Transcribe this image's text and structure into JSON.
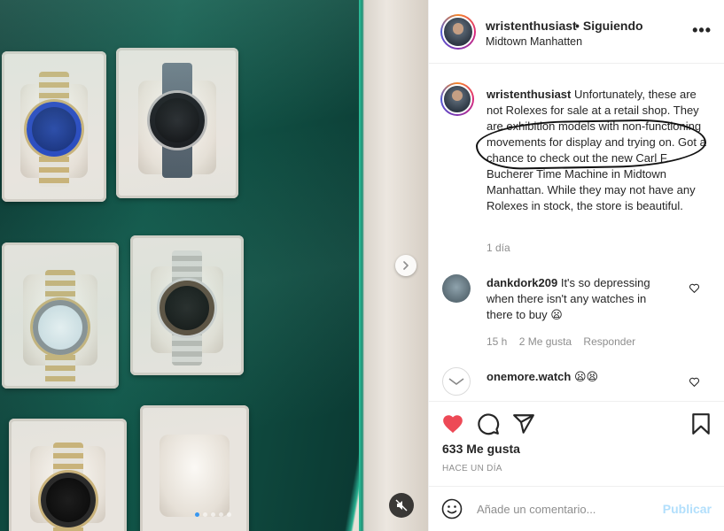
{
  "post": {
    "username": "wristenthusiast",
    "follow_separator": "•",
    "follow_status": "Siguiendo",
    "location": "Midtown Manhatten",
    "more_label": "•••"
  },
  "caption": {
    "username": "wristenthusiast",
    "text": "Unfortunately, these are not Rolexes for sale at a retail shop. They are exhibition models with non-functioning movements for display and trying on. Got a chance to check out the new Carl F. Bucherer Time Machine in Midtown Manhattan. While they may not have any Rolexes in stock, the store is beautiful.",
    "time": "1 día"
  },
  "comments": [
    {
      "username": "dankdork209",
      "text": "It's so depressing when there isn't any watches in there to buy",
      "emoji": "😦",
      "time": "15 h",
      "likes": "2 Me gusta",
      "reply": "Responder"
    },
    {
      "username": "onemore.watch",
      "text": "",
      "emoji": "😦😫"
    }
  ],
  "actions": {
    "likes_count": "633 Me gusta",
    "posted_ago": "HACE UN DÍA",
    "liked": true,
    "like_color": "#ed4956"
  },
  "composer": {
    "placeholder": "Añade un comentario...",
    "post_label": "Publicar",
    "post_color": "#b2dffc"
  },
  "carousel": {
    "slide_count": 5,
    "active_slide": 1,
    "dot_color": "#3897f0"
  },
  "icons": {
    "next": "chevron-right-icon",
    "mute": "muted-speaker-icon",
    "like": "heart-icon",
    "comment": "comment-icon",
    "share": "paper-plane-icon",
    "save": "bookmark-icon",
    "emoji": "smiley-icon"
  }
}
